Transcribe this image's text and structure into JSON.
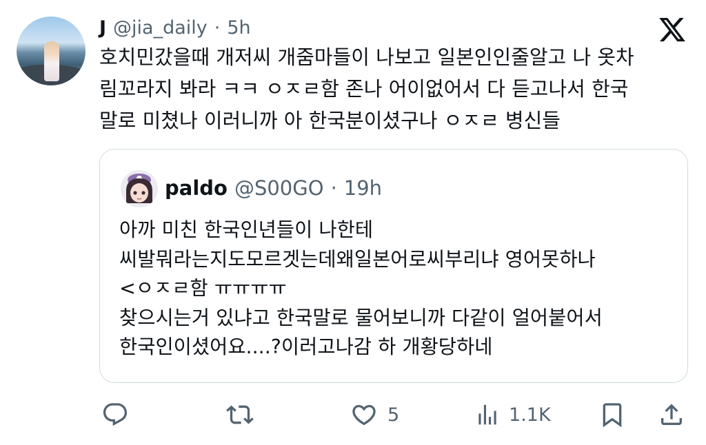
{
  "tweet": {
    "display_name": "J",
    "handle": "@jia_daily",
    "separator": "·",
    "time": "5h",
    "lines": [
      "호치민갔을때 개저씨 개줌마들이 나보고 일본인인줄알고 나 옷차",
      "림꼬라지 봐라 ㅋㅋ ㅇㅈㄹ함 존나 어이없어서 다 듣고나서 한국",
      "말로 미쳤나 이러니까 아 한국분이셨구나 ㅇㅈㄹ 병신들"
    ]
  },
  "quote": {
    "display_name": "paldo",
    "handle": "@S00GO",
    "separator": "·",
    "time": "19h",
    "lines": [
      "아까 미친 한국인년들이 나한테",
      "씨발뭐라는지도모르겟는데왜일본어로씨부리냐 영어못하나",
      "<ㅇㅈㄹ함 ㅠㅠㅠㅠ",
      "찾으시는거 있냐고 한국말로 물어보니까  다같이 얼어붙어서",
      "한국인이셨어요....?이러고나감 하 개황당하네"
    ]
  },
  "actions": {
    "reply_icon": "reply-icon",
    "retweet_icon": "retweet-icon",
    "like_icon": "heart-icon",
    "like_count": "5",
    "views_icon": "views-icon",
    "views_count": "1.1K",
    "bookmark_icon": "bookmark-icon",
    "share_icon": "share-icon"
  },
  "colors": {
    "text": "#0f1419",
    "secondary": "#536471",
    "border": "#cfd9de"
  }
}
